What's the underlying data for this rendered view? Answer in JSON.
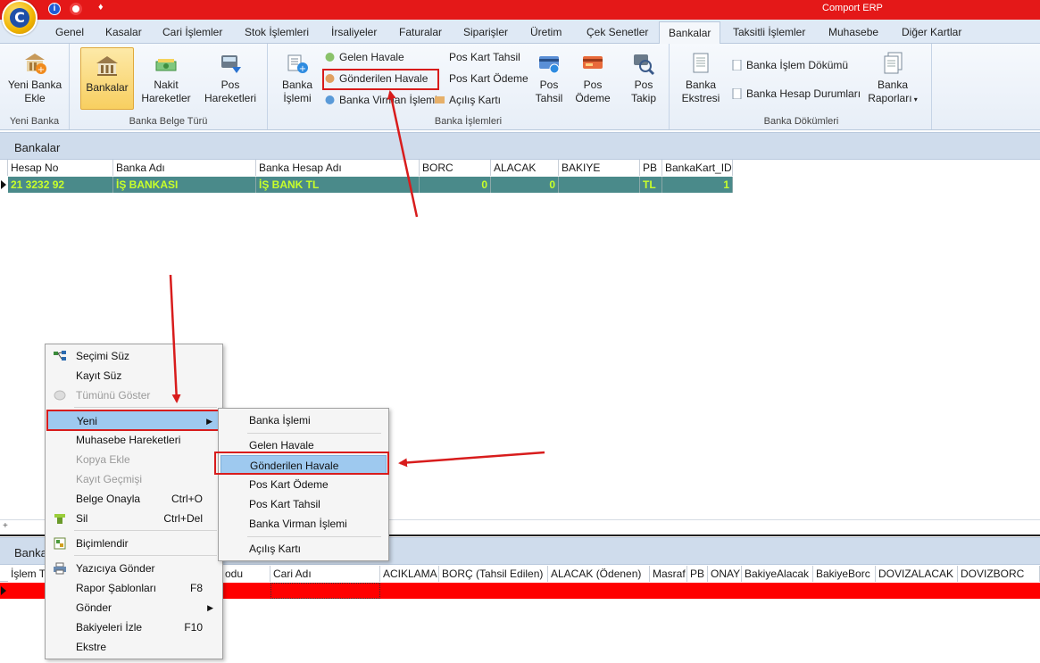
{
  "app": {
    "title": "Comport ERP",
    "logo_letter": "C"
  },
  "titlebar_icons": [
    "info-icon",
    "help-icon",
    "pin-icon"
  ],
  "tabs": [
    {
      "label": "Genel"
    },
    {
      "label": "Kasalar"
    },
    {
      "label": "Cari İşlemler"
    },
    {
      "label": "Stok İşlemleri"
    },
    {
      "label": "İrsaliyeler"
    },
    {
      "label": "Faturalar"
    },
    {
      "label": "Siparişler"
    },
    {
      "label": "Üretim"
    },
    {
      "label": "Çek Senetler"
    },
    {
      "label": "Bankalar",
      "active": true
    },
    {
      "label": "Taksitli İşlemler"
    },
    {
      "label": "Muhasebe"
    },
    {
      "label": "Diğer Kartlar"
    }
  ],
  "ribbon": {
    "yeni_banka": {
      "button": "Yeni Banka Ekle",
      "group": "Yeni Banka"
    },
    "belge_turu": {
      "group": "Banka Belge Türü",
      "bankalar": "Bankalar",
      "nakit": "Nakit Hareketler",
      "pos": "Pos Hareketleri"
    },
    "islemler": {
      "group": "Banka İşlemleri",
      "banka_islemi": "Banka İşlemi",
      "gelen_havale": "Gelen Havale",
      "gonderilen_havale": "Gönderilen Havale",
      "virman": "Banka Virman İşlemi",
      "pos_kart_tahsil": "Pos Kart Tahsil",
      "pos_kart_odeme": "Pos Kart Ödeme",
      "acilis_karti": "Açılış Kartı",
      "pos_tahsil": "Pos Tahsil",
      "pos_odeme": "Pos Ödeme",
      "pos_takip": "Pos Takip"
    },
    "dokumler": {
      "group": "Banka Dökümleri",
      "ekstre": "Banka Ekstresi",
      "islem_dokumu": "Banka İşlem Dökümü",
      "hesap_durumlari": "Banka Hesap Durumları",
      "raporlari": "Banka Raporları"
    }
  },
  "bankalar_grid": {
    "title": "Bankalar",
    "columns": [
      "Hesap No",
      "Banka Adı",
      "Banka Hesap Adı",
      "BORC",
      "ALACAK",
      "BAKIYE",
      "PB",
      "BankaKart_ID"
    ],
    "rows": [
      [
        "21 3232 92",
        "İŞ BANKASI",
        "İŞ BANK TL",
        "0",
        "0",
        "",
        "TL",
        "1"
      ]
    ]
  },
  "hareket_grid": {
    "title": "Banka",
    "columns": [
      "İşlem T",
      "odu",
      "Cari Adı",
      "ACIKLAMA",
      "BORÇ (Tahsil Edilen)",
      "ALACAK (Ödenen)",
      "Masraf",
      "PB",
      "ONAY",
      "BakiyeAlacak",
      "BakiyeBorc",
      "DOVIZALACAK",
      "DOVIZBORC"
    ]
  },
  "context_menu": {
    "items": [
      {
        "label": "Seçimi Süz",
        "icon": "filter-selection-icon"
      },
      {
        "label": "Kayıt Süz"
      },
      {
        "label": "Tümünü Göster",
        "disabled": true,
        "icon": "show-all-icon"
      },
      {
        "label": "Yeni",
        "submenu": true
      },
      {
        "label": "Muhasebe Hareketleri"
      },
      {
        "label": "Kopya Ekle",
        "disabled": true
      },
      {
        "label": "Kayıt Geçmişi",
        "disabled": true
      },
      {
        "label": "Belge Onayla",
        "shortcut": "Ctrl+O"
      },
      {
        "label": "Sil",
        "shortcut": "Ctrl+Del",
        "icon": "delete-icon"
      },
      {
        "label": "Biçimlendir",
        "icon": "format-icon"
      },
      {
        "label": "Yazıcıya Gönder",
        "icon": "printer-icon"
      },
      {
        "label": "Rapor Şablonları",
        "shortcut": "F8"
      },
      {
        "label": "Gönder",
        "submenu": true
      },
      {
        "label": "Bakiyeleri İzle",
        "shortcut": "F10"
      },
      {
        "label": "Ekstre"
      }
    ]
  },
  "submenu": {
    "items": [
      {
        "label": "Banka İşlemi"
      },
      {
        "label": "Gelen Havale"
      },
      {
        "label": "Gönderilen Havale"
      },
      {
        "label": "Pos Kart Ödeme"
      },
      {
        "label": "Pos Kart Tahsil"
      },
      {
        "label": "Banka Virman İşlemi"
      },
      {
        "label": "Açılış Kartı"
      }
    ]
  },
  "colors": {
    "titlebar": "#e41818",
    "selected_row": "#4a8a8a",
    "selected_row_text": "#c8ff2a",
    "hareket_row": "#ff0000",
    "annotation": "#d81c1c"
  }
}
